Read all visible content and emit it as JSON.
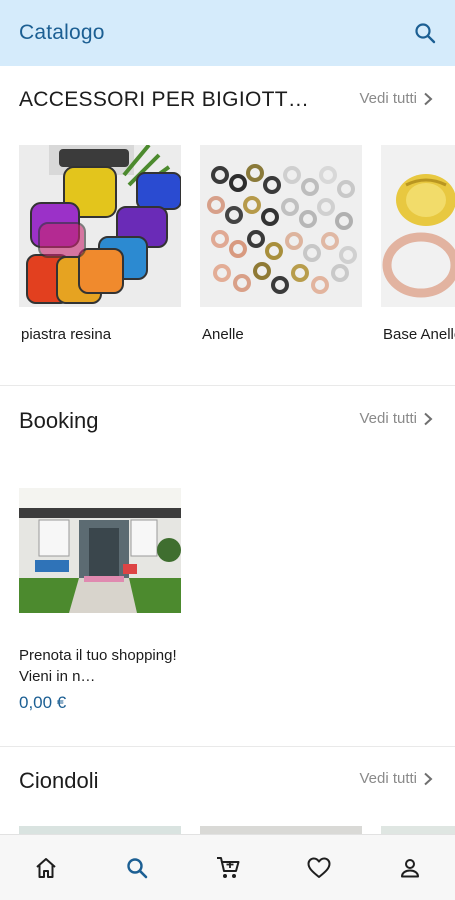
{
  "app": {
    "title": "Catalogo"
  },
  "sections": [
    {
      "title": "ACCESSORI PER BIGIOTTERIA",
      "see_all": "Vedi tutti",
      "items": [
        {
          "name": "piastra resina"
        },
        {
          "name": "Anelle"
        },
        {
          "name": "Base Anello"
        }
      ]
    },
    {
      "title": "Booking",
      "see_all": "Vedi tutti",
      "items": [
        {
          "name": "Prenota il tuo shopping! Vieni in n…",
          "price": "0,00 €"
        }
      ]
    },
    {
      "title": "Ciondoli",
      "see_all": "Vedi tutti"
    }
  ],
  "nav": [
    {
      "icon": "home-icon"
    },
    {
      "icon": "search-icon",
      "active": true
    },
    {
      "icon": "cart-icon"
    },
    {
      "icon": "heart-icon"
    },
    {
      "icon": "profile-icon"
    }
  ],
  "colors": {
    "appbar_bg": "#d5ebfb",
    "primary": "#1c5f93",
    "muted": "#8a8a8a"
  }
}
